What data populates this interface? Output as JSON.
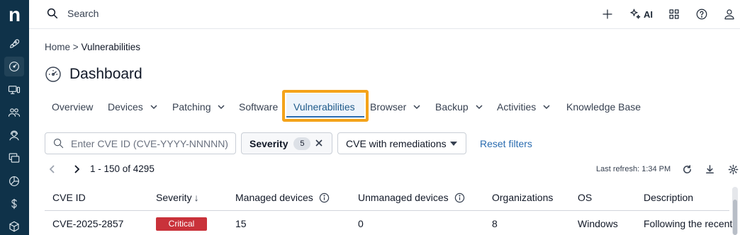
{
  "brand": {
    "logo_letter": "n",
    "rail_color": "#0f3249",
    "accent": "#2a6cb0",
    "highlight": "#f4a31a"
  },
  "rail": {
    "items": [
      {
        "icon": "rocket-icon"
      },
      {
        "icon": "dashboard-gauge-icon",
        "active": true
      },
      {
        "icon": "devices-icon"
      },
      {
        "icon": "users-icon"
      },
      {
        "icon": "support-agent-icon"
      },
      {
        "icon": "windows-icon"
      },
      {
        "icon": "pie-chart-icon"
      },
      {
        "icon": "dollar-icon"
      },
      {
        "icon": "package-icon"
      }
    ]
  },
  "topbar": {
    "search_placeholder": "Search",
    "ai_label": "AI",
    "icons": [
      "plus-icon",
      "ai-sparkle-icon",
      "apps-grid-icon",
      "help-icon",
      "user-icon"
    ]
  },
  "breadcrumb": {
    "home": "Home",
    "separator": ">",
    "current": "Vulnerabilities"
  },
  "page_title": "Dashboard",
  "tabs": [
    {
      "label": "Overview",
      "has_menu": false
    },
    {
      "label": "Devices",
      "has_menu": true
    },
    {
      "label": "Patching",
      "has_menu": true
    },
    {
      "label": "Software",
      "has_menu": false
    },
    {
      "label": "Vulnerabilities",
      "has_menu": false,
      "active": true
    },
    {
      "label": "Browser",
      "has_menu": true
    },
    {
      "label": "Backup",
      "has_menu": true
    },
    {
      "label": "Activities",
      "has_menu": true
    },
    {
      "label": "Knowledge Base",
      "has_menu": false
    }
  ],
  "filters": {
    "cve_placeholder": "Enter CVE ID (CVE-YYYY-NNNNN)",
    "severity_label": "Severity",
    "severity_count": "5",
    "cve_select_value": "CVE with remediations",
    "reset_label": "Reset filters"
  },
  "pagination": {
    "range": "1 - 150 of 4295",
    "last_refresh": "Last refresh: 1:34 PM"
  },
  "table": {
    "columns": [
      "CVE ID",
      "Severity",
      "Managed devices",
      "Unmanaged devices",
      "Organizations",
      "OS",
      "Description"
    ],
    "sort_indicator": "↓",
    "rows": [
      {
        "cve_id": "CVE-2025-2857",
        "severity": "Critical",
        "severity_color": "#c9323a",
        "managed": "15",
        "unmanaged": "0",
        "organizations": "8",
        "os": "Windows",
        "description": "Following the recent"
      }
    ]
  }
}
